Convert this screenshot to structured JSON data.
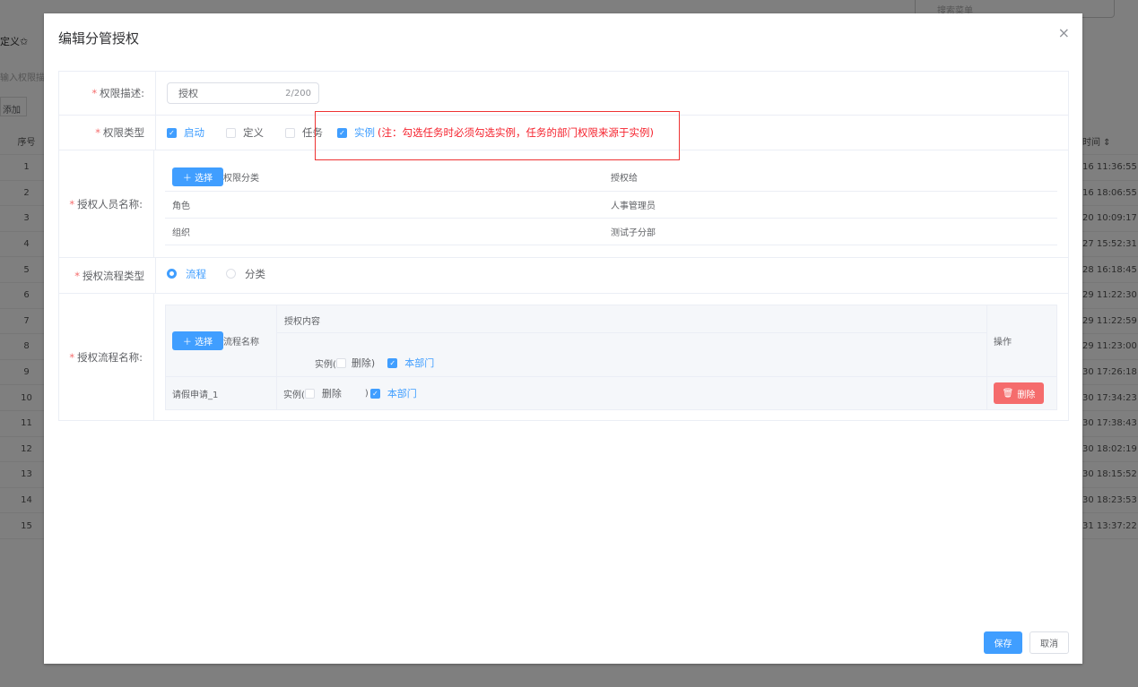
{
  "background": {
    "search_placeholder": "搜索菜单",
    "tab": "定义✩",
    "input_placeholder": "输入权限描述",
    "add": "添加",
    "col_index": "序号",
    "col_time": "时间 ⇕",
    "rows": [
      {
        "i": "1",
        "t": "16 11:36:55"
      },
      {
        "i": "2",
        "t": "16 18:06:55"
      },
      {
        "i": "3",
        "t": "20 10:09:17"
      },
      {
        "i": "4",
        "t": "27 15:52:31"
      },
      {
        "i": "5",
        "t": "28 16:18:45"
      },
      {
        "i": "6",
        "t": "29 11:22:30"
      },
      {
        "i": "7",
        "t": "29 11:22:59"
      },
      {
        "i": "8",
        "t": "29 11:23:00"
      },
      {
        "i": "9",
        "t": "30 17:26:18"
      },
      {
        "i": "10",
        "t": "30 17:34:23"
      },
      {
        "i": "11",
        "t": "30 17:38:43"
      },
      {
        "i": "12",
        "t": "30 18:02:19"
      },
      {
        "i": "13",
        "t": "30 18:15:52"
      },
      {
        "i": "14",
        "t": "30 18:23:53"
      },
      {
        "i": "15",
        "t": "31 13:37:22"
      }
    ]
  },
  "modal": {
    "title": "编辑分管授权",
    "close": "×",
    "desc": {
      "label": "权限描述:",
      "value": "授权",
      "count": "2/200"
    },
    "type": {
      "label": "权限类型",
      "options": [
        {
          "label": "启动",
          "checked": true
        },
        {
          "label": "定义",
          "checked": false
        },
        {
          "label": "任务",
          "checked": false
        },
        {
          "label": "实例",
          "checked": true
        }
      ],
      "note": "(注：勾选任务时必须勾选实例，任务的部门权限来源于实例)"
    },
    "persons": {
      "label": "授权人员名称:",
      "select": "＋ 选择",
      "col1": "权限分类",
      "col2": "授权给",
      "rows": [
        {
          "c": "角色",
          "t": "人事管理员"
        },
        {
          "c": "组织",
          "t": "测试子分部"
        }
      ]
    },
    "flow_type": {
      "label": "授权流程类型",
      "options": [
        {
          "label": "流程",
          "selected": true
        },
        {
          "label": "分类",
          "selected": false
        }
      ]
    },
    "flows": {
      "label": "授权流程名称:",
      "select": "＋ 选择",
      "col_name": "流程名称",
      "col_content": "授权内容",
      "col_op": "操作",
      "header_instance": "实例(",
      "header_delete": "删除)",
      "header_dept": "本部门",
      "rows": [
        {
          "name": "请假申请_1",
          "instance": "实例(",
          "delete": "删除",
          "close": ")",
          "dept": "本部门",
          "delete_btn": "删除"
        }
      ]
    },
    "save": "保存",
    "cancel": "取消"
  },
  "colors": {
    "primary": "#409eff",
    "danger": "#f56c6c",
    "note": "#f5222d"
  }
}
